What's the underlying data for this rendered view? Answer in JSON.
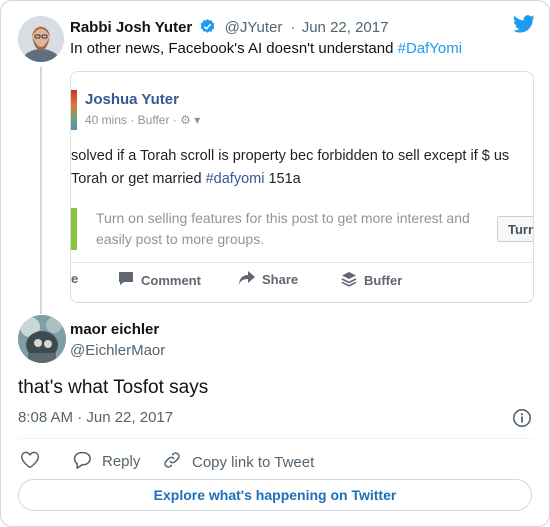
{
  "tweet": {
    "author_name": "Rabbi Josh Yuter",
    "author_handle": "@JYuter",
    "date_separator": "·",
    "date": "Jun 22, 2017",
    "text": "In other news, Facebook's AI doesn't understand ",
    "hashtag": "#DafYomi"
  },
  "embedded_post": {
    "poster_name": "Joshua Yuter",
    "meta": "40 mins · Buffer · ",
    "text_line1": "solved if a Torah scroll is property bec forbidden to sell except if $ us",
    "text_line2_prefix": "Torah or get married ",
    "text_line2_hashtag": "#dafyomi",
    "text_line2_suffix": " 151a",
    "promo_text": "Turn on selling features for this post to get more interest and easily post to more groups.",
    "promo_button": "Turn",
    "action_partial": "e",
    "action_comment": "Comment",
    "action_share": "Share",
    "action_buffer": "Buffer"
  },
  "reply": {
    "author_name": "maor eichler",
    "author_handle": "@EichlerMaor",
    "text": "that's what Tosfot says",
    "time": "8:08 AM · Jun 22, 2017"
  },
  "actions": {
    "reply_label": "Reply",
    "copy_label": "Copy link to Tweet"
  },
  "footer": {
    "explore_label": "Explore what's happening on Twitter"
  },
  "colors": {
    "twitter_blue": "#1d9bf0",
    "facebook_link": "#365899",
    "promo_green": "#8ac33f"
  }
}
